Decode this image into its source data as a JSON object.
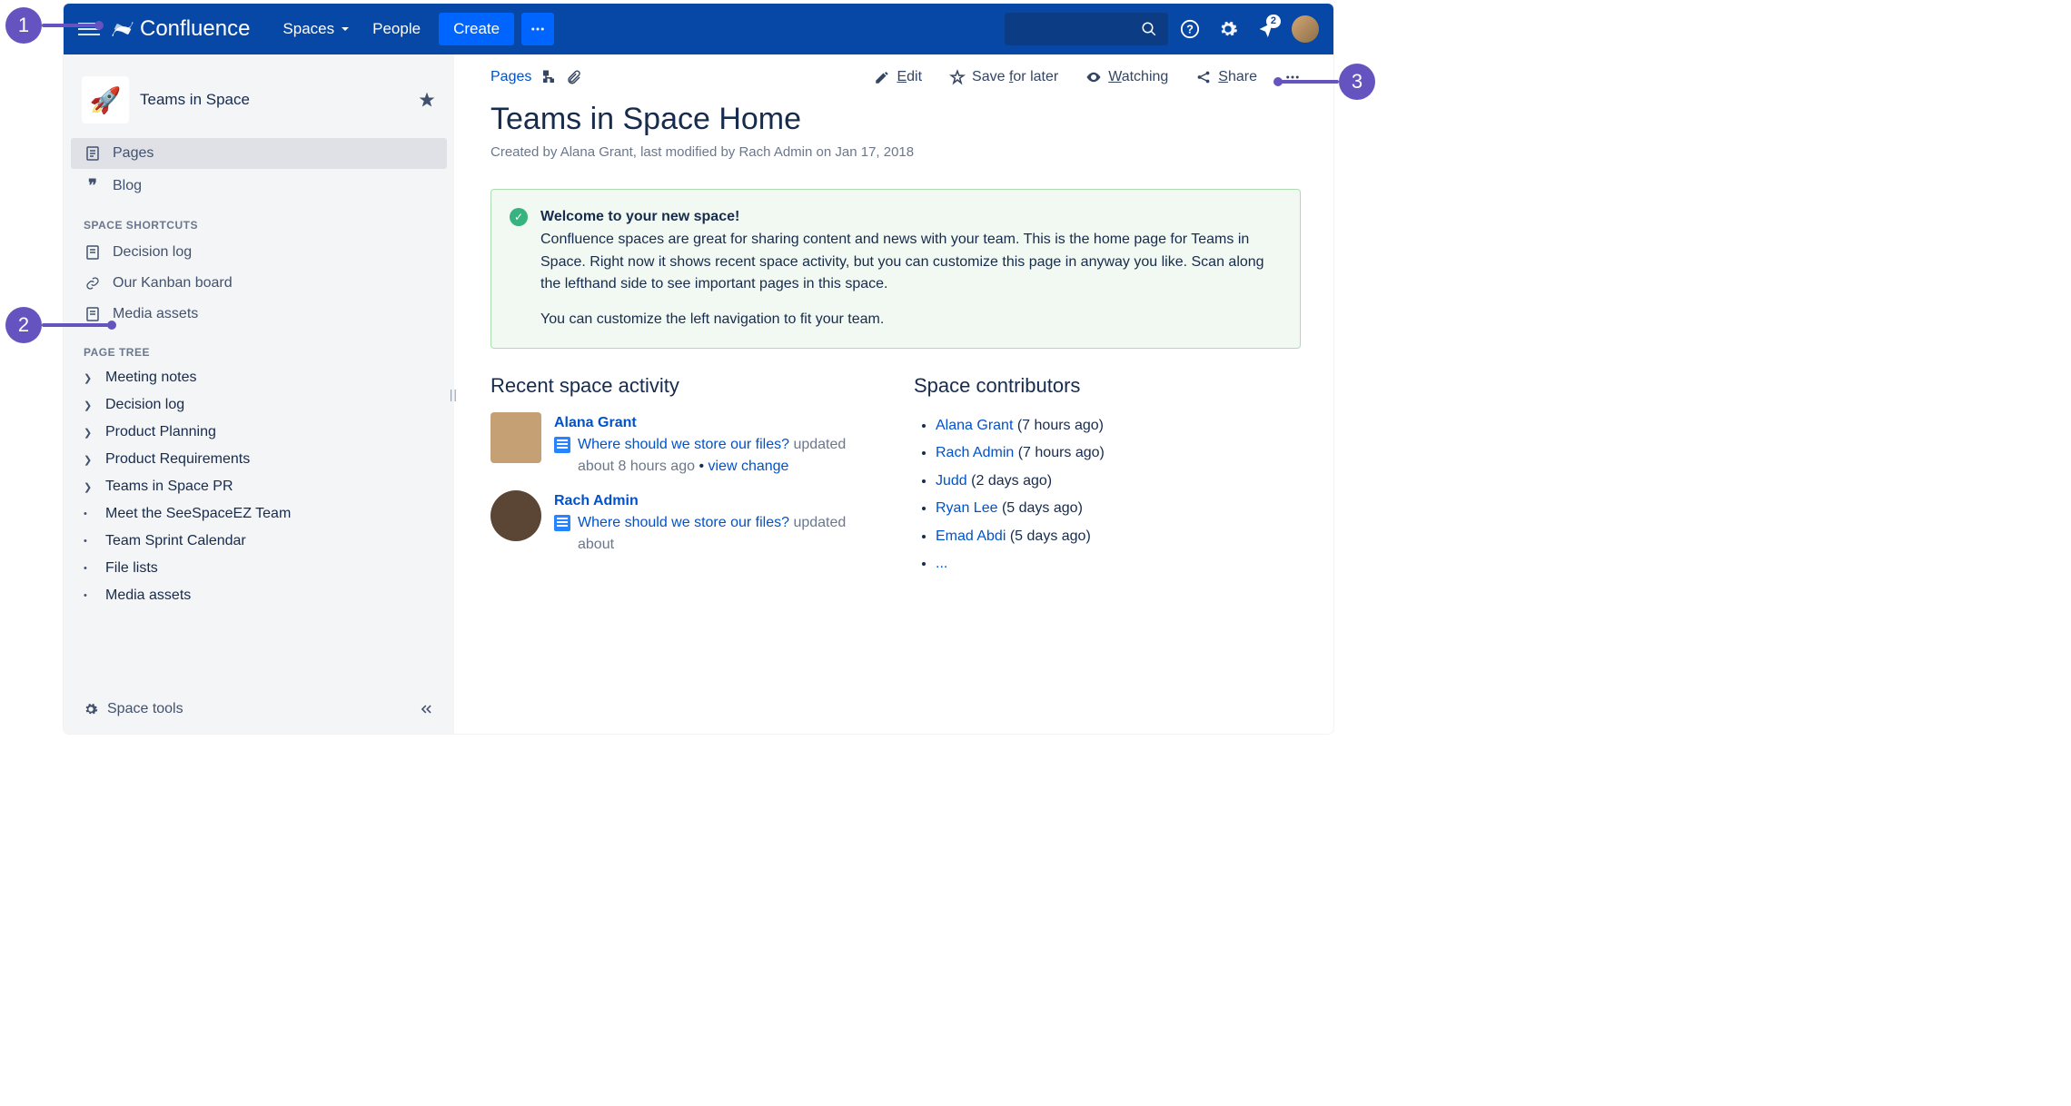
{
  "callouts": {
    "c1": "1",
    "c2": "2",
    "c3": "3"
  },
  "nav": {
    "product": "Confluence",
    "spaces": "Spaces",
    "people": "People",
    "create": "Create",
    "notification_count": "2"
  },
  "sidebar": {
    "space_name": "Teams in Space",
    "pages": "Pages",
    "blog": "Blog",
    "section_shortcuts": "SPACE SHORTCUTS",
    "shortcuts": [
      {
        "label": "Decision log",
        "icon": "page"
      },
      {
        "label": "Our Kanban board",
        "icon": "link"
      },
      {
        "label": "Media assets",
        "icon": "page"
      }
    ],
    "section_tree": "PAGE TREE",
    "tree": [
      {
        "label": "Meeting notes",
        "expandable": true
      },
      {
        "label": "Decision log",
        "expandable": true
      },
      {
        "label": "Product Planning",
        "expandable": true
      },
      {
        "label": "Product Requirements",
        "expandable": true
      },
      {
        "label": "Teams in Space PR",
        "expandable": true
      },
      {
        "label": "Meet the SeeSpaceEZ Team",
        "expandable": false
      },
      {
        "label": "Team Sprint Calendar",
        "expandable": false
      },
      {
        "label": "File lists",
        "expandable": false
      },
      {
        "label": "Media assets",
        "expandable": false
      }
    ],
    "footer": "Space tools"
  },
  "page": {
    "actions": {
      "pages": "Pages",
      "edit_u": "E",
      "edit_rest": "dit",
      "save_pre": "Save ",
      "save_u": "f",
      "save_rest": "or later",
      "watch_u": "W",
      "watch_rest": "atching",
      "share_u": "S",
      "share_rest": "hare"
    },
    "title": "Teams in Space Home",
    "byline": "Created by Alana Grant, last modified by Rach Admin on Jan 17, 2018",
    "panel": {
      "heading": "Welcome to your new space!",
      "body": "Confluence spaces are great for sharing content and news with your team. This is the home page for Teams in Space. Right now it shows recent space activity, but you can customize this page in anyway you like. Scan along the lefthand side to see important pages in this space.",
      "body2": "You can customize the left navigation to fit your team."
    },
    "recent_heading": "Recent space activity",
    "activity": [
      {
        "user": "Alana Grant",
        "link": "Where should we store our files?",
        "meta": "updated about 8 hours ago",
        "change": "view change",
        "round": false
      },
      {
        "user": "Rach Admin",
        "link": "Where should we store our files?",
        "meta": "updated about",
        "change": "",
        "round": true
      }
    ],
    "contrib_heading": "Space contributors",
    "contributors": [
      {
        "name": "Alana Grant",
        "ago": "(7 hours ago)"
      },
      {
        "name": "Rach Admin",
        "ago": "(7 hours ago)"
      },
      {
        "name": "Judd",
        "ago": "(2 days ago)"
      },
      {
        "name": "Ryan Lee",
        "ago": "(5 days ago)"
      },
      {
        "name": "Emad Abdi",
        "ago": "(5 days ago)"
      },
      {
        "name": "...",
        "ago": ""
      }
    ]
  }
}
